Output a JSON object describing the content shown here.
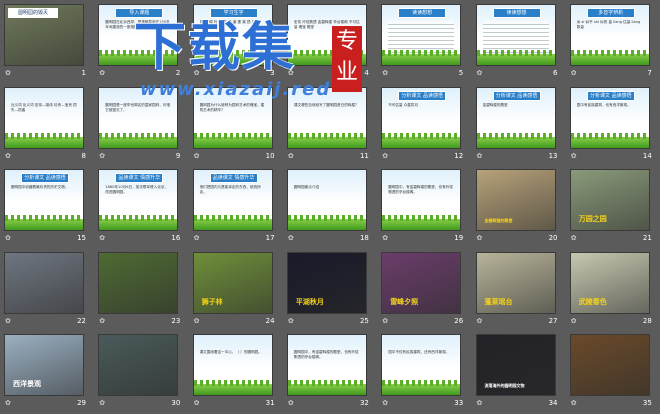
{
  "slides": [
    {
      "n": "1",
      "kind": "photo",
      "title": "圆明园的毁灭",
      "bg": "#6f7a5a"
    },
    {
      "n": "2",
      "kind": "doc",
      "title": "导入课题",
      "text": "圆明园在北京西郊，是清朝皇帝在150多年间建造的一座规模宏大的皇家园林。"
    },
    {
      "n": "3",
      "kind": "doc",
      "title": "学习生字",
      "text": "毁 殿 煌 玲 珑 缩 宋 瀛 蓬 莱 损 矣"
    },
    {
      "n": "4",
      "kind": "doc",
      "title": "",
      "text": "宏伟 玲珑剔透 金碧辉煌 亭台楼阁 不可估量 瑰宝 殿堂"
    },
    {
      "n": "5",
      "kind": "doc",
      "title": "读读想想",
      "text": ""
    },
    {
      "n": "6",
      "kind": "doc",
      "title": "读读想想",
      "text": ""
    },
    {
      "n": "7",
      "kind": "doc",
      "title": "多音字辨析",
      "text": "似 si 似乎 shi 似的 量 liang 估量 liang 数量"
    },
    {
      "n": "8",
      "kind": "doc",
      "title": "",
      "text": "近义词 反义词 宏伟—雄伟 珍贵—宝贵 损失—损害"
    },
    {
      "n": "9",
      "kind": "doc",
      "title": "",
      "text": "圆明园是一座举世闻名的皇家园林，可惜它被毁灭了。"
    },
    {
      "n": "10",
      "kind": "doc",
      "title": "",
      "text": "圆明园为什么被称为园林艺术的瑰宝，建筑艺术的精华？"
    },
    {
      "n": "11",
      "kind": "doc",
      "title": "",
      "text": "课文哪些自然段写了圆明园昔日的辉煌？"
    },
    {
      "n": "12",
      "kind": "doc",
      "title": "分析课文 品读感悟",
      "text": "不可估量 众星拱月"
    },
    {
      "n": "13",
      "kind": "doc",
      "title": "分析课文 品读感悟",
      "text": "金碧辉煌的殿堂"
    },
    {
      "n": "14",
      "kind": "doc",
      "title": "分析课文 品读感悟",
      "text": "园中有民族建筑，也有西洋景观。"
    },
    {
      "n": "15",
      "kind": "doc",
      "title": "分析课文 品读感悟",
      "text": "圆明园中收藏着最珍贵的历史文物。"
    },
    {
      "n": "16",
      "kind": "doc",
      "title": "品读课文 情感升华",
      "text": "1860年10月6日，英法联军侵入北京，闯进圆明园。"
    },
    {
      "n": "17",
      "kind": "doc",
      "title": "品读课文 情感升华",
      "text": "他们把园内凡是能拿走的东西，统统掠走。"
    },
    {
      "n": "18",
      "kind": "doc",
      "title": "",
      "text": "圆明园景点介绍"
    },
    {
      "n": "19",
      "kind": "doc",
      "title": "",
      "text": "圆明园中，有金碧辉煌的殿堂，也有玲珑剔透的亭台楼阁。"
    },
    {
      "n": "20",
      "kind": "photo",
      "title": "",
      "caption": "金碧辉煌的殿堂",
      "bg": "#b7a27a"
    },
    {
      "n": "21",
      "kind": "photo",
      "title": "",
      "caption": "万园之园",
      "bg": "#8a9a7a"
    },
    {
      "n": "22",
      "kind": "photo",
      "title": "",
      "caption": "",
      "bg": "#6f7680"
    },
    {
      "n": "23",
      "kind": "photo",
      "title": "",
      "caption": "",
      "bg": "#4e6a33"
    },
    {
      "n": "24",
      "kind": "photo",
      "title": "",
      "caption": "狮子林",
      "bg": "#6f8f3a"
    },
    {
      "n": "25",
      "kind": "photo",
      "title": "",
      "caption": "平湖秋月",
      "bg": "#1a1a2a"
    },
    {
      "n": "26",
      "kind": "photo",
      "title": "",
      "caption": "雷峰夕照",
      "bg": "#6a3d6a"
    },
    {
      "n": "27",
      "kind": "photo",
      "title": "",
      "caption": "蓬莱瑶台",
      "bg": "#b8b49a"
    },
    {
      "n": "28",
      "kind": "photo",
      "title": "",
      "caption": "武陵春色",
      "bg": "#c7c8b0"
    },
    {
      "n": "29",
      "kind": "photo",
      "title": "",
      "caption": "西洋景观",
      "bg": "#9bb0c2"
    },
    {
      "n": "30",
      "kind": "photo",
      "title": "",
      "caption": "",
      "bg": "#4a5a5a"
    },
    {
      "n": "31",
      "kind": "doc",
      "title": "",
      "text": "课文围绕着这一中心，（ ）的圆明园。"
    },
    {
      "n": "32",
      "kind": "doc",
      "title": "",
      "text": "圆明园中，有金碧辉煌的殿堂，也有玲珑剔透的亭台楼阁。"
    },
    {
      "n": "33",
      "kind": "doc",
      "title": "",
      "text": "园中不仅有民族建筑，还有西洋景观。"
    },
    {
      "n": "34",
      "kind": "photo",
      "title": "",
      "caption": "流落海外的圆明园文物",
      "bg": "#222228"
    },
    {
      "n": "35",
      "kind": "photo",
      "title": "",
      "caption": "",
      "bg": "#6a4a2a"
    }
  ],
  "watermark": {
    "main": "下载集",
    "url": "www.xiazaij.red",
    "seal": "专业"
  },
  "colors": {
    "bg": "#5b5b5b",
    "title_bar": "#2a7fc9",
    "grass": "#3f9a1d"
  }
}
